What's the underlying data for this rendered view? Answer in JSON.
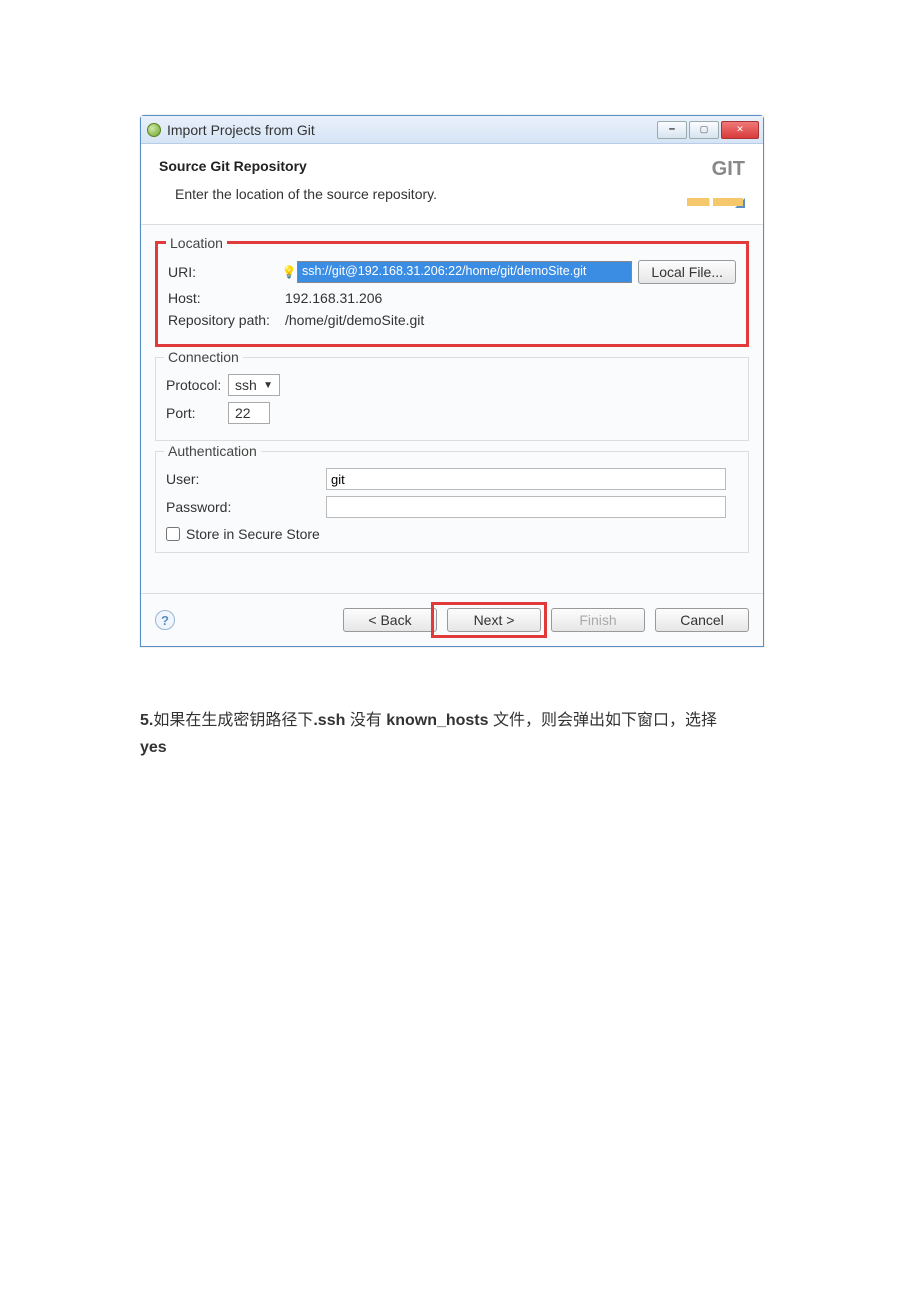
{
  "window": {
    "title": "Import Projects from Git"
  },
  "header": {
    "title": "Source Git Repository",
    "subtitle": "Enter the location of the source repository.",
    "badge": "GIT"
  },
  "location": {
    "legend": "Location",
    "uri_label": "URI:",
    "uri_value": "ssh://git@192.168.31.206:22/home/git/demoSite.git",
    "local_file_btn": "Local File...",
    "host_label": "Host:",
    "host_value": "192.168.31.206",
    "repo_label": "Repository path:",
    "repo_value": "/home/git/demoSite.git"
  },
  "connection": {
    "legend": "Connection",
    "protocol_label": "Protocol:",
    "protocol_value": "ssh",
    "port_label": "Port:",
    "port_value": "22"
  },
  "auth": {
    "legend": "Authentication",
    "user_label": "User:",
    "user_value": "git",
    "password_label": "Password:",
    "password_value": "",
    "store_label": "Store in Secure Store"
  },
  "footer": {
    "back": "< Back",
    "next": "Next >",
    "finish": "Finish",
    "cancel": "Cancel"
  },
  "doc": {
    "step_num": "5.",
    "part1": "如果在生成密钥路径下",
    "bold1": ".ssh",
    "part2": "没有",
    "bold2": "known_hosts",
    "part3": "文件，则会弹出如下窗口，选择",
    "bold3": "yes"
  }
}
